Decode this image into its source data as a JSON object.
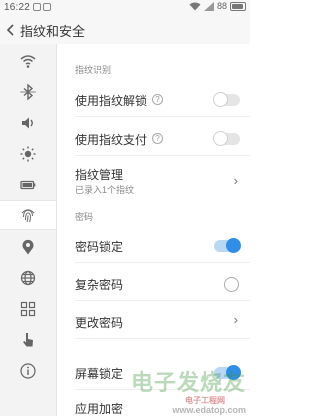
{
  "status": {
    "time": "16:22",
    "battery": "88"
  },
  "appbar": {
    "title": "指纹和安全"
  },
  "sidebar": {
    "icons": [
      "wifi-icon",
      "bluetooth-icon",
      "volume-icon",
      "brightness-icon",
      "battery-icon",
      "fingerprint-icon",
      "location-icon",
      "globe-icon",
      "apps-grid-icon",
      "hand-pointer-icon",
      "info-icon"
    ],
    "active_index": 5
  },
  "sections": {
    "fingerprint": "指纹识别",
    "password": "密码"
  },
  "rows": {
    "unlock": {
      "label": "使用指纹解锁",
      "help": "?"
    },
    "pay": {
      "label": "使用指纹支付",
      "help": "?"
    },
    "manage": {
      "label": "指纹管理",
      "sub": "已录入1个指纹"
    },
    "lock_password": {
      "label": "密码锁定"
    },
    "complex_password": {
      "label": "复杂密码"
    },
    "change_password": {
      "label": "更改密码"
    },
    "screen_lock": {
      "label": "屏幕锁定"
    },
    "app_lock": {
      "label": "应用加密"
    }
  },
  "toggles": {
    "unlock": false,
    "pay": false,
    "lock_password": true,
    "screen_lock": true
  },
  "watermark": {
    "title": "电子发烧友",
    "sub": "电子工程网",
    "url": "www.edatop.com"
  },
  "colors": {
    "accent": "#2f8fe8",
    "watermark": "#3c963c"
  }
}
